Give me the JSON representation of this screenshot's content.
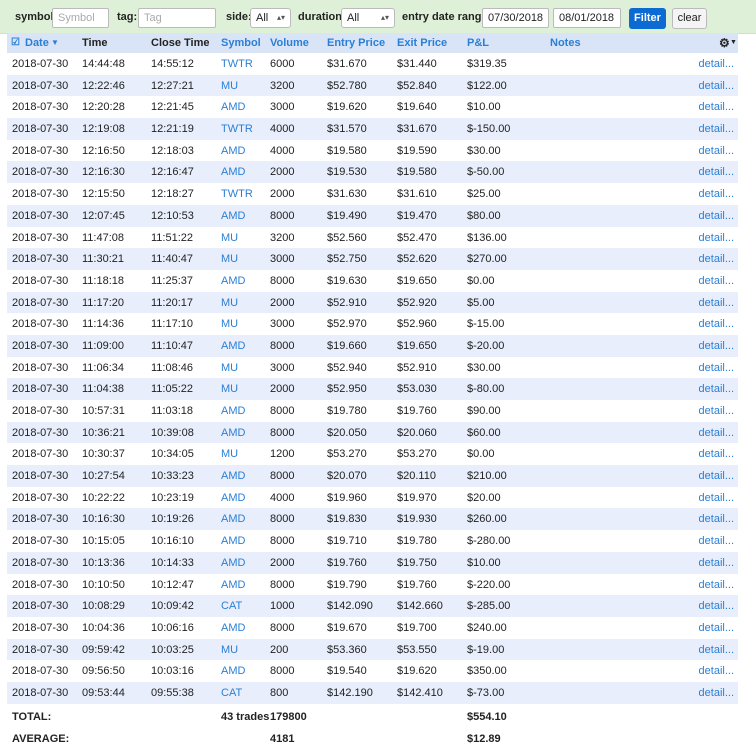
{
  "filters": {
    "symbol_label": "symbol:",
    "symbol_placeholder": "Symbol",
    "tag_label": "tag:",
    "tag_placeholder": "Tag",
    "side_label": "side:",
    "side_value": "All",
    "duration_label": "duration:",
    "duration_value": "All",
    "date_range_label": "entry date range:",
    "date_from": "07/30/2018",
    "date_to": "08/01/2018",
    "filter_button": "Filter",
    "clear_button": "clear"
  },
  "table": {
    "columns": {
      "date": "Date",
      "time": "Time",
      "close_time": "Close Time",
      "symbol": "Symbol",
      "volume": "Volume",
      "entry_price": "Entry Price",
      "exit_price": "Exit Price",
      "pl": "P&L",
      "notes": "Notes"
    },
    "detail_label": "detail...",
    "rows": [
      [
        "2018-07-30",
        "14:44:48",
        "14:55:12",
        "TWTR",
        "6000",
        "$31.670",
        "$31.440",
        "$319.35"
      ],
      [
        "2018-07-30",
        "12:22:46",
        "12:27:21",
        "MU",
        "3200",
        "$52.780",
        "$52.840",
        "$122.00"
      ],
      [
        "2018-07-30",
        "12:20:28",
        "12:21:45",
        "AMD",
        "3000",
        "$19.620",
        "$19.640",
        "$10.00"
      ],
      [
        "2018-07-30",
        "12:19:08",
        "12:21:19",
        "TWTR",
        "4000",
        "$31.570",
        "$31.670",
        "$-150.00"
      ],
      [
        "2018-07-30",
        "12:16:50",
        "12:18:03",
        "AMD",
        "4000",
        "$19.580",
        "$19.590",
        "$30.00"
      ],
      [
        "2018-07-30",
        "12:16:30",
        "12:16:47",
        "AMD",
        "2000",
        "$19.530",
        "$19.580",
        "$-50.00"
      ],
      [
        "2018-07-30",
        "12:15:50",
        "12:18:27",
        "TWTR",
        "2000",
        "$31.630",
        "$31.610",
        "$25.00"
      ],
      [
        "2018-07-30",
        "12:07:45",
        "12:10:53",
        "AMD",
        "8000",
        "$19.490",
        "$19.470",
        "$80.00"
      ],
      [
        "2018-07-30",
        "11:47:08",
        "11:51:22",
        "MU",
        "3200",
        "$52.560",
        "$52.470",
        "$136.00"
      ],
      [
        "2018-07-30",
        "11:30:21",
        "11:40:47",
        "MU",
        "3000",
        "$52.750",
        "$52.620",
        "$270.00"
      ],
      [
        "2018-07-30",
        "11:18:18",
        "11:25:37",
        "AMD",
        "8000",
        "$19.630",
        "$19.650",
        "$0.00"
      ],
      [
        "2018-07-30",
        "11:17:20",
        "11:20:17",
        "MU",
        "2000",
        "$52.910",
        "$52.920",
        "$5.00"
      ],
      [
        "2018-07-30",
        "11:14:36",
        "11:17:10",
        "MU",
        "3000",
        "$52.970",
        "$52.960",
        "$-15.00"
      ],
      [
        "2018-07-30",
        "11:09:00",
        "11:10:47",
        "AMD",
        "8000",
        "$19.660",
        "$19.650",
        "$-20.00"
      ],
      [
        "2018-07-30",
        "11:06:34",
        "11:08:46",
        "MU",
        "3000",
        "$52.940",
        "$52.910",
        "$30.00"
      ],
      [
        "2018-07-30",
        "11:04:38",
        "11:05:22",
        "MU",
        "2000",
        "$52.950",
        "$53.030",
        "$-80.00"
      ],
      [
        "2018-07-30",
        "10:57:31",
        "11:03:18",
        "AMD",
        "8000",
        "$19.780",
        "$19.760",
        "$90.00"
      ],
      [
        "2018-07-30",
        "10:36:21",
        "10:39:08",
        "AMD",
        "8000",
        "$20.050",
        "$20.060",
        "$60.00"
      ],
      [
        "2018-07-30",
        "10:30:37",
        "10:34:05",
        "MU",
        "1200",
        "$53.270",
        "$53.270",
        "$0.00"
      ],
      [
        "2018-07-30",
        "10:27:54",
        "10:33:23",
        "AMD",
        "8000",
        "$20.070",
        "$20.110",
        "$210.00"
      ],
      [
        "2018-07-30",
        "10:22:22",
        "10:23:19",
        "AMD",
        "4000",
        "$19.960",
        "$19.970",
        "$20.00"
      ],
      [
        "2018-07-30",
        "10:16:30",
        "10:19:26",
        "AMD",
        "8000",
        "$19.830",
        "$19.930",
        "$260.00"
      ],
      [
        "2018-07-30",
        "10:15:05",
        "10:16:10",
        "AMD",
        "8000",
        "$19.710",
        "$19.780",
        "$-280.00"
      ],
      [
        "2018-07-30",
        "10:13:36",
        "10:14:33",
        "AMD",
        "2000",
        "$19.760",
        "$19.750",
        "$10.00"
      ],
      [
        "2018-07-30",
        "10:10:50",
        "10:12:47",
        "AMD",
        "8000",
        "$19.790",
        "$19.760",
        "$-220.00"
      ],
      [
        "2018-07-30",
        "10:08:29",
        "10:09:42",
        "CAT",
        "1000",
        "$142.090",
        "$142.660",
        "$-285.00"
      ],
      [
        "2018-07-30",
        "10:04:36",
        "10:06:16",
        "AMD",
        "8000",
        "$19.670",
        "$19.700",
        "$240.00"
      ],
      [
        "2018-07-30",
        "09:59:42",
        "10:03:25",
        "MU",
        "200",
        "$53.360",
        "$53.550",
        "$-19.00"
      ],
      [
        "2018-07-30",
        "09:56:50",
        "10:03:16",
        "AMD",
        "8000",
        "$19.540",
        "$19.620",
        "$350.00"
      ],
      [
        "2018-07-30",
        "09:53:44",
        "09:55:38",
        "CAT",
        "800",
        "$142.190",
        "$142.410",
        "$-73.00"
      ]
    ]
  },
  "totals": {
    "total_label": "TOTAL:",
    "trades": "43 trades",
    "volume": "179800",
    "pl": "$554.10"
  },
  "average": {
    "label": "AVERAGE:",
    "volume": "4181",
    "pl": "$12.89"
  },
  "colors": {
    "filter_bar_bg": "#dff0d8",
    "header_bg": "#d9e5f7",
    "alt_row_bg": "#e8eefb",
    "link": "#2a7fd4",
    "filter_button_bg": "#0b6bd3"
  }
}
